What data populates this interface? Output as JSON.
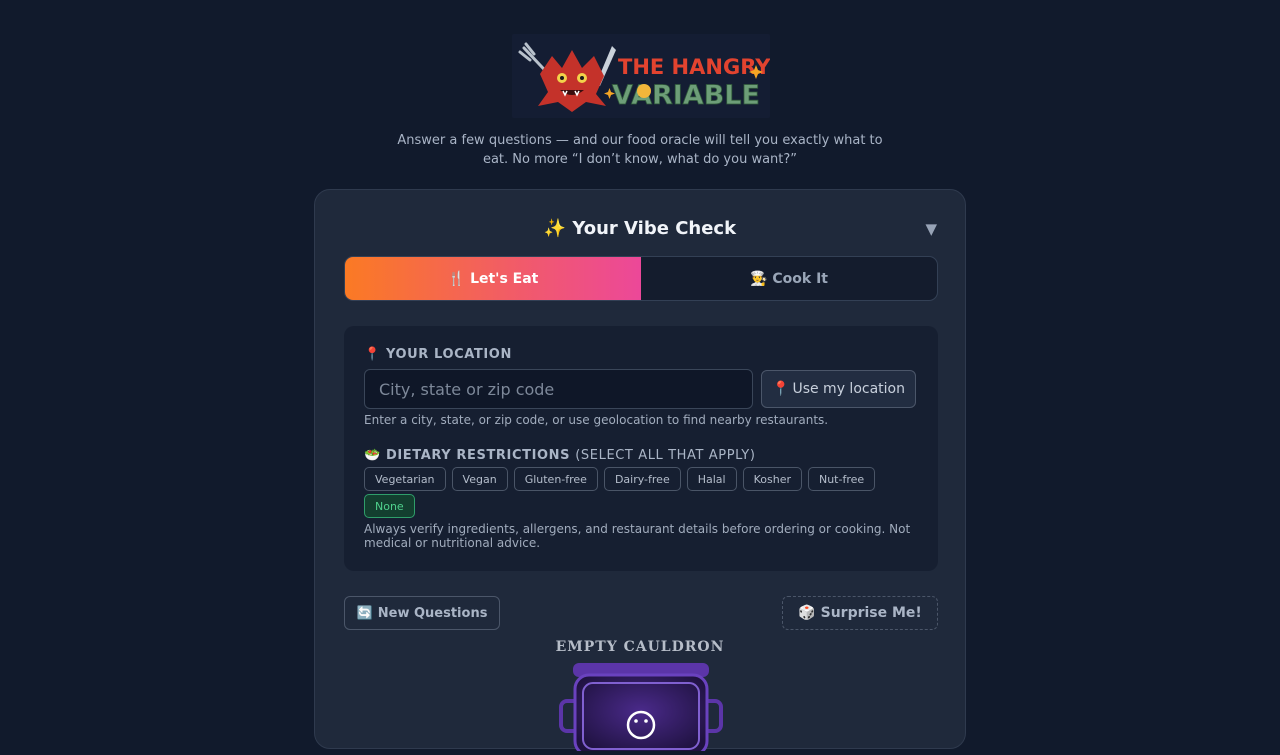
{
  "logo": {
    "text_line1": "THE HANGRY",
    "text_line2": "VARIABLE"
  },
  "tagline": "Answer a few questions — and our food oracle will tell you exactly what to eat. No more “I don’t know, what do you want?”",
  "card": {
    "title": "Your Vibe Check",
    "title_icon": "sparkles-icon",
    "collapse_glyph": "▼",
    "modes": [
      {
        "label": "Let's Eat",
        "icon": "fork-knife-icon",
        "active": true
      },
      {
        "label": "Cook It",
        "icon": "chef-icon",
        "active": false
      }
    ],
    "location": {
      "label": "YOUR LOCATION",
      "icon": "pin-icon",
      "placeholder": "City, state or zip code",
      "value": "",
      "geo_button": "Use my location",
      "geo_icon": "crosshair-icon",
      "hint": "Enter a city, state, or zip code, or use geolocation to find nearby restaurants."
    },
    "dietary": {
      "label": "DIETARY RESTRICTIONS",
      "label_sub": "(SELECT ALL THAT APPLY)",
      "icon": "leaf-icon",
      "options": [
        "Vegetarian",
        "Vegan",
        "Gluten-free",
        "Dairy-free",
        "Halal",
        "Kosher",
        "Nut-free",
        "None"
      ],
      "selected": "None",
      "disclaimer": "Always verify ingredients, allergens, and restaurant details before ordering or cooking. Not medical or nutritional advice."
    },
    "actions": {
      "new_questions": "New Questions",
      "new_questions_icon": "refresh-icon",
      "surprise": "Surprise Me!",
      "surprise_icon": "dice-icon"
    },
    "cauldron_label": "EMPTY CAULDRON"
  },
  "colors": {
    "background": "#111a2c",
    "card": "#1f293b",
    "accent_start": "#fb7a24",
    "accent_end": "#ec4899",
    "selected_chip": "#4fd08c"
  }
}
